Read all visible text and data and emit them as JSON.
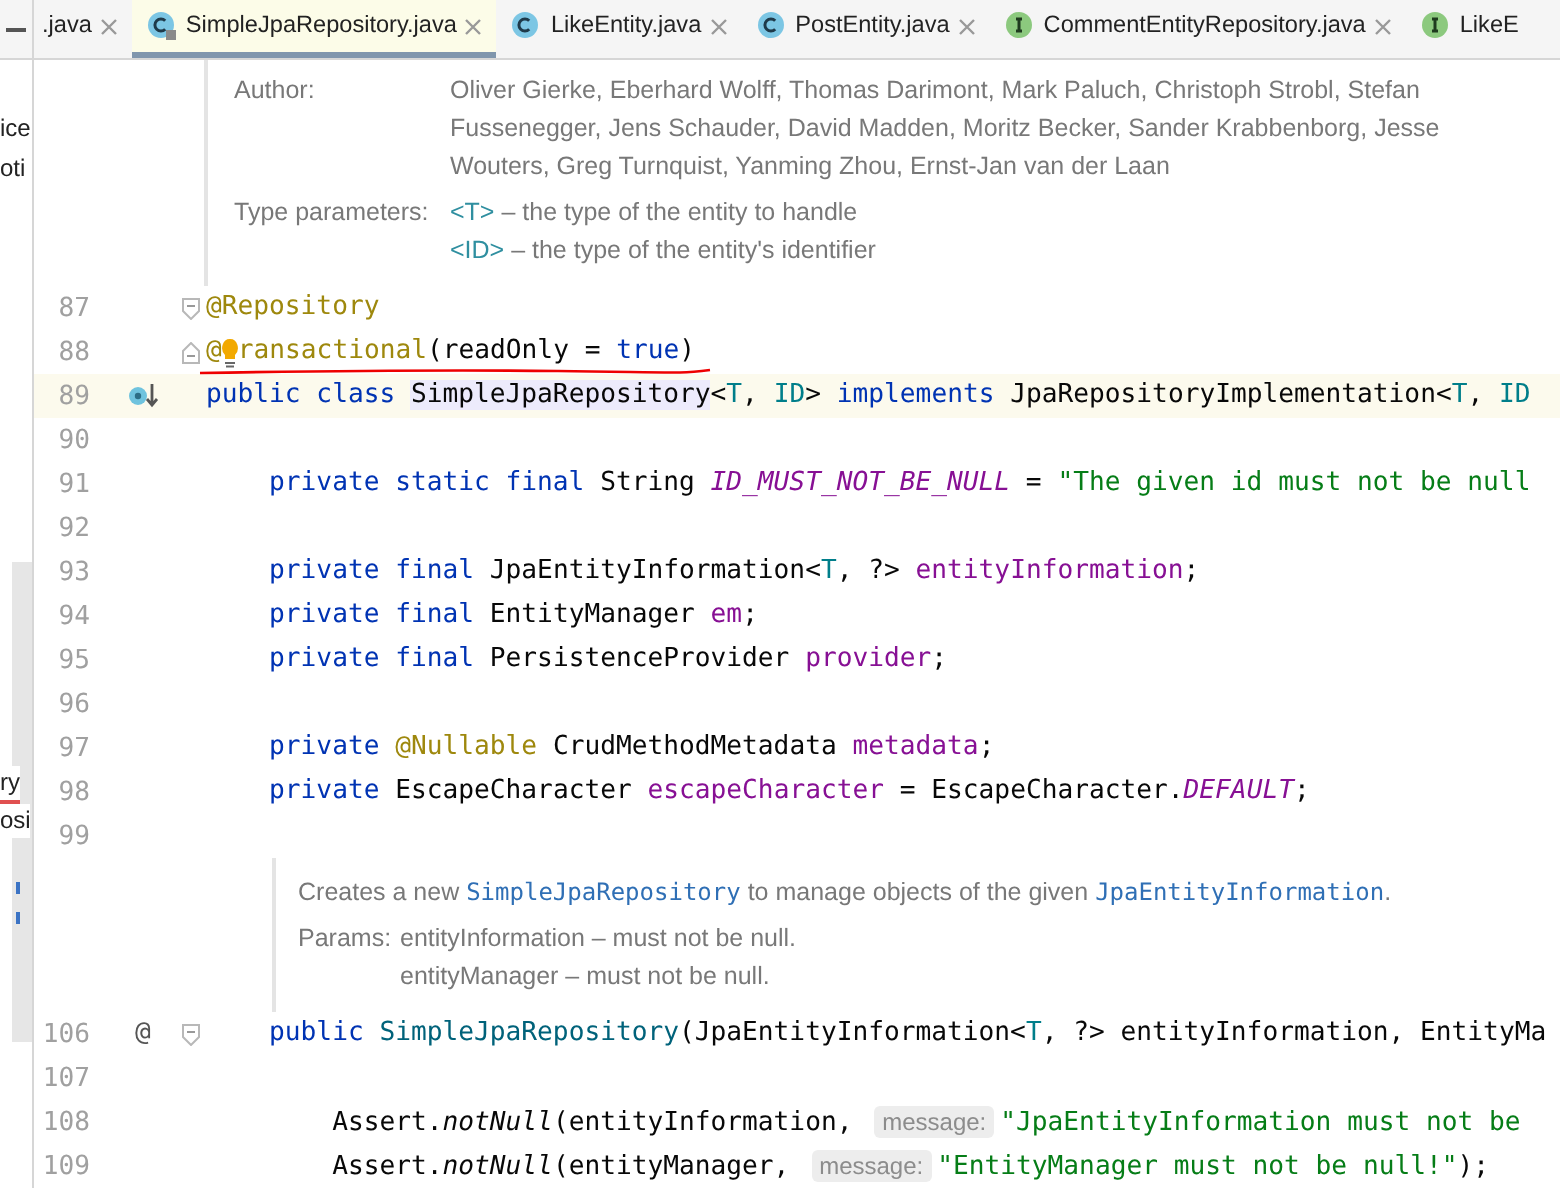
{
  "left_panel": {
    "items": [
      {
        "label": "ice",
        "error": false
      },
      {
        "label": "oti",
        "error": false
      }
    ],
    "lower_items": [
      {
        "label": "ry",
        "error": true
      },
      {
        "label": "osi",
        "error": false
      }
    ]
  },
  "tabs": [
    {
      "label": ".java",
      "kind": "file",
      "selected": false
    },
    {
      "label": "SimpleJpaRepository.java",
      "kind": "class",
      "locked": true,
      "selected": true
    },
    {
      "label": "LikeEntity.java",
      "kind": "class",
      "locked": false,
      "selected": false
    },
    {
      "label": "PostEntity.java",
      "kind": "class",
      "locked": false,
      "selected": false
    },
    {
      "label": "CommentEntityRepository.java",
      "kind": "interface",
      "locked": false,
      "selected": false
    },
    {
      "label": "LikeE",
      "kind": "interface",
      "locked": false,
      "selected": false
    }
  ],
  "doc_header": {
    "author_label": "Author:",
    "author_lines": [
      "Oliver Gierke, Eberhard Wolff, Thomas Darimont, Mark Paluch, Christoph Strobl, Stefan",
      "Fussenegger, Jens Schauder, David Madden, Moritz Becker, Sander Krabbenborg, Jesse",
      "Wouters, Greg Turnquist, Yanming Zhou, Ernst-Jan van der Laan"
    ],
    "type_params_label": "Type parameters:",
    "type_params": [
      {
        "param": "<T>",
        "text": " – the type of the entity to handle"
      },
      {
        "param": "<ID>",
        "text": " – the type of the entity's identifier"
      }
    ]
  },
  "code": [
    {
      "kind": "code",
      "number": "87",
      "fold_start": true,
      "tokens": [
        {
          "kind": "annotation",
          "text": "@Repository"
        }
      ]
    },
    {
      "kind": "code",
      "number": "88",
      "fold_end": true,
      "intention": true,
      "error_underline": true,
      "before_tokens": [
        {
          "kind": "annotation",
          "text": "@"
        }
      ],
      "tokens": [
        {
          "kind": "annotation",
          "text": "ransactional"
        },
        {
          "kind": "plain",
          "text": "(readOnly = "
        },
        {
          "kind": "keyword",
          "text": "true"
        },
        {
          "kind": "plain",
          "text": ")"
        }
      ]
    },
    {
      "kind": "code",
      "number": "89",
      "current": true,
      "implemented": true,
      "tokens": [
        {
          "kind": "keyword",
          "text": "public class "
        },
        {
          "kind": "highlight",
          "text": "SimpleJpaRepository"
        },
        {
          "kind": "plain",
          "text": "<"
        },
        {
          "kind": "type_param",
          "text": "T"
        },
        {
          "kind": "plain",
          "text": ", "
        },
        {
          "kind": "type_param",
          "text": "ID"
        },
        {
          "kind": "plain",
          "text": "> "
        },
        {
          "kind": "keyword",
          "text": "implements "
        },
        {
          "kind": "plain",
          "text": "JpaRepositoryImplementation<"
        },
        {
          "kind": "type_param",
          "text": "T"
        },
        {
          "kind": "plain",
          "text": ", "
        },
        {
          "kind": "type_param",
          "text": "ID"
        }
      ]
    },
    {
      "kind": "code",
      "number": "90"
    },
    {
      "kind": "code",
      "number": "91",
      "tokens": [
        {
          "kind": "keyword",
          "text": "    private static final "
        },
        {
          "kind": "plain",
          "text": "String "
        },
        {
          "kind": "static",
          "text": "ID_MUST_NOT_BE_NULL"
        },
        {
          "kind": "plain",
          "text": " = "
        },
        {
          "kind": "string",
          "text": "\"The given id must not be null"
        }
      ]
    },
    {
      "kind": "code",
      "number": "92"
    },
    {
      "kind": "code",
      "number": "93",
      "tokens": [
        {
          "kind": "keyword",
          "text": "    private final "
        },
        {
          "kind": "plain",
          "text": "JpaEntityInformation<"
        },
        {
          "kind": "type_param",
          "text": "T"
        },
        {
          "kind": "plain",
          "text": ", ?> "
        },
        {
          "kind": "field",
          "text": "entityInformation"
        },
        {
          "kind": "plain",
          "text": ";"
        }
      ]
    },
    {
      "kind": "code",
      "number": "94",
      "tokens": [
        {
          "kind": "keyword",
          "text": "    private final "
        },
        {
          "kind": "plain",
          "text": "EntityManager "
        },
        {
          "kind": "field",
          "text": "em"
        },
        {
          "kind": "plain",
          "text": ";"
        }
      ]
    },
    {
      "kind": "code",
      "number": "95",
      "tokens": [
        {
          "kind": "keyword",
          "text": "    private final "
        },
        {
          "kind": "plain",
          "text": "PersistenceProvider "
        },
        {
          "kind": "field",
          "text": "provider"
        },
        {
          "kind": "plain",
          "text": ";"
        }
      ]
    },
    {
      "kind": "code",
      "number": "96"
    },
    {
      "kind": "code",
      "number": "97",
      "tokens": [
        {
          "kind": "keyword",
          "text": "    private "
        },
        {
          "kind": "annotation",
          "text": "@Nullable"
        },
        {
          "kind": "plain",
          "text": " CrudMethodMetadata "
        },
        {
          "kind": "field",
          "text": "metadata"
        },
        {
          "kind": "plain",
          "text": ";"
        }
      ]
    },
    {
      "kind": "code",
      "number": "98",
      "tokens": [
        {
          "kind": "keyword",
          "text": "    private "
        },
        {
          "kind": "plain",
          "text": "EscapeCharacter "
        },
        {
          "kind": "field",
          "text": "escapeCharacter"
        },
        {
          "kind": "plain",
          "text": " = EscapeCharacter."
        },
        {
          "kind": "static",
          "text": "DEFAULT"
        },
        {
          "kind": "plain",
          "text": ";"
        }
      ]
    },
    {
      "kind": "code",
      "number": "99"
    },
    {
      "kind": "doc",
      "summary": [
        {
          "kind": "text",
          "text": "Creates a new "
        },
        {
          "kind": "link",
          "text": "SimpleJpaRepository"
        },
        {
          "kind": "text",
          "text": " to manage objects of the given "
        },
        {
          "kind": "link",
          "text": "JpaEntityInformation"
        },
        {
          "kind": "text",
          "text": "."
        }
      ],
      "params_label": "Params:",
      "params": [
        "entityInformation – must not be null.",
        "entityManager – must not be null."
      ]
    },
    {
      "kind": "code",
      "number": "106",
      "fold_start": true,
      "gutter_text": "@",
      "tokens": [
        {
          "kind": "keyword",
          "text": "    public "
        },
        {
          "kind": "method",
          "text": "SimpleJpaRepository"
        },
        {
          "kind": "plain",
          "text": "(JpaEntityInformation<"
        },
        {
          "kind": "type_param",
          "text": "T"
        },
        {
          "kind": "plain",
          "text": ", ?> entityInformation, EntityMa"
        }
      ]
    },
    {
      "kind": "code",
      "number": "107"
    },
    {
      "kind": "code",
      "number": "108",
      "tokens": [
        {
          "kind": "plain",
          "text": "        Assert."
        },
        {
          "kind": "static_call",
          "text": "notNull"
        },
        {
          "kind": "plain",
          "text": "(entityInformation, "
        },
        {
          "kind": "hint",
          "text": "message:"
        },
        {
          "kind": "string",
          "text": "\"JpaEntityInformation must not be"
        }
      ]
    },
    {
      "kind": "code",
      "number": "109",
      "tokens": [
        {
          "kind": "plain",
          "text": "        Assert."
        },
        {
          "kind": "static_call",
          "text": "notNull"
        },
        {
          "kind": "plain",
          "text": "(entityManager, "
        },
        {
          "kind": "hint",
          "text": "message:"
        },
        {
          "kind": "string",
          "text": "\"EntityManager must not be null!\""
        },
        {
          "kind": "plain",
          "text": ");"
        }
      ]
    }
  ]
}
